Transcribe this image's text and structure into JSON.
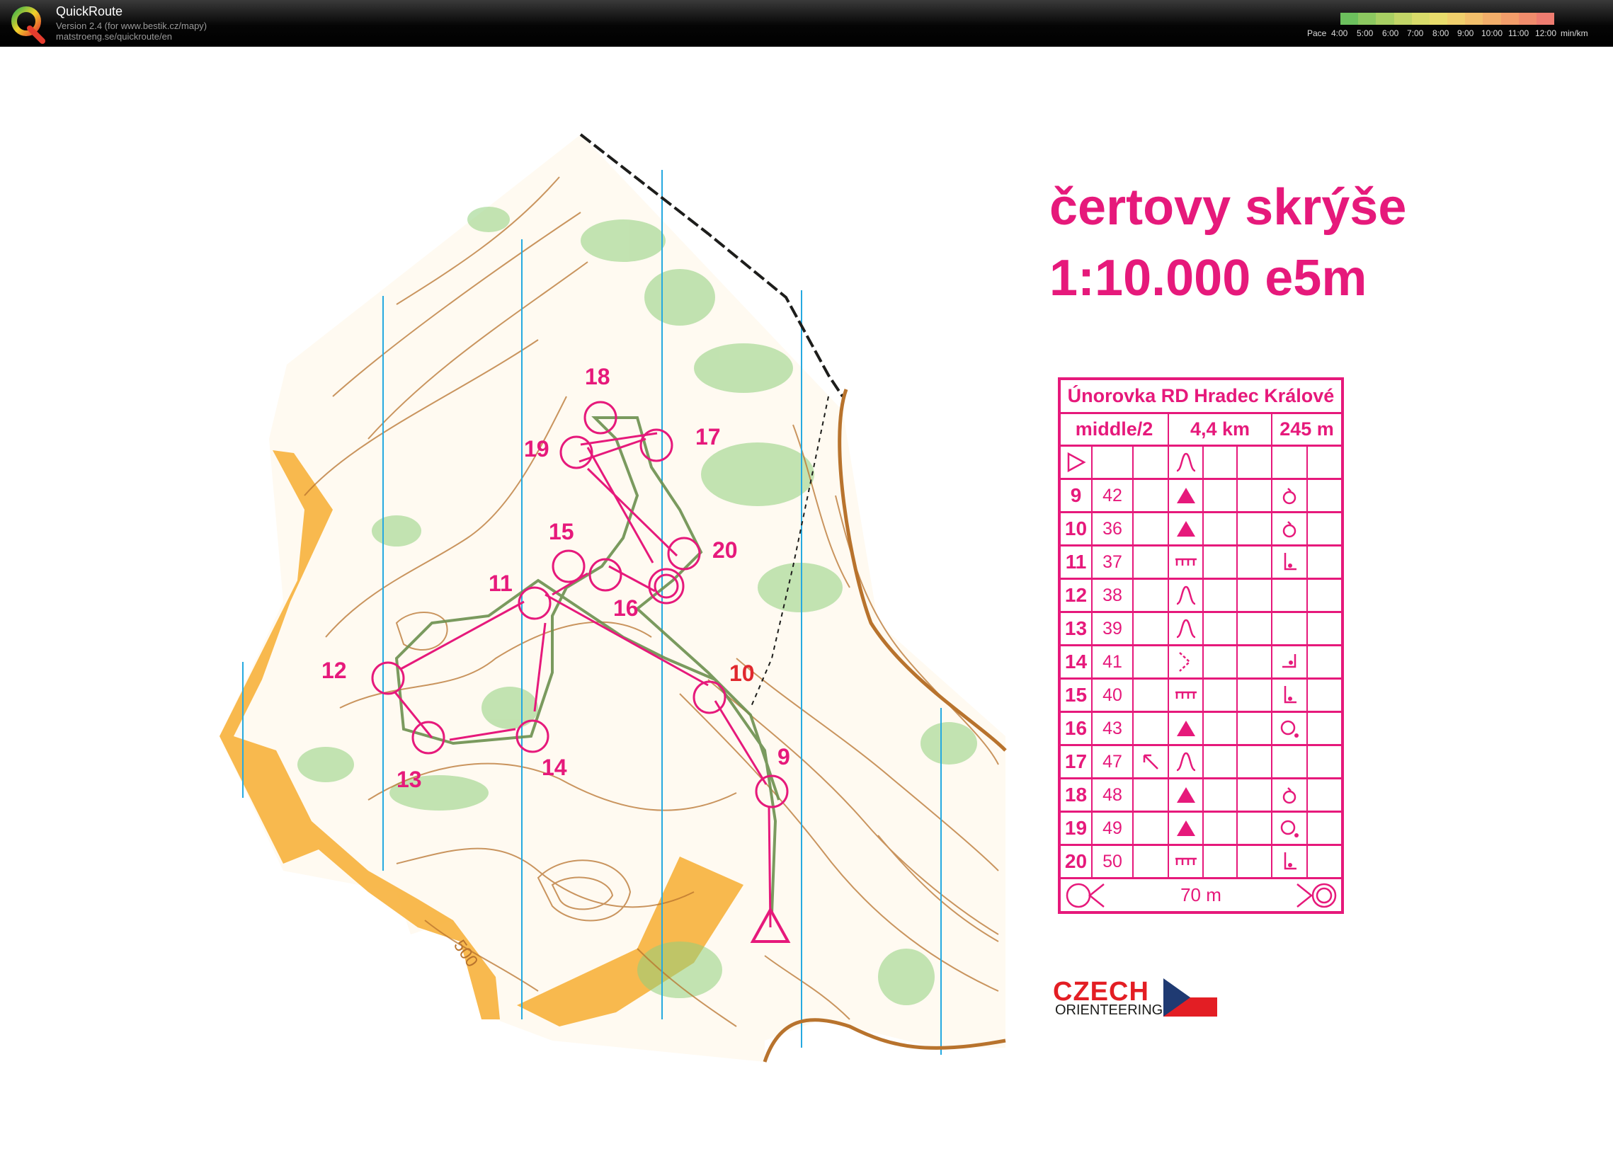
{
  "app": {
    "name": "QuickRoute",
    "version": "Version 2.4  (for www.bestik.cz/mapy)",
    "url": "matstroeng.se/quickroute/en"
  },
  "pace_legend": {
    "label": "Pace",
    "ticks": [
      "4:00",
      "5:00",
      "6:00",
      "7:00",
      "8:00",
      "9:00",
      "10:00",
      "11:00",
      "12:00"
    ],
    "unit": "min/km",
    "colors": [
      "#6cc05d",
      "#8cc860",
      "#a8cf63",
      "#c2d567",
      "#d8db6a",
      "#e9dc6c",
      "#f0cf6c",
      "#f2bf6b",
      "#f2ae6a",
      "#f29d6a",
      "#f08c6c",
      "#ee7c70"
    ]
  },
  "map": {
    "title": "čertovy skrýše",
    "scale_line": "1:10.000  e5m",
    "contour_label": "500",
    "colors": {
      "course": "#e6197b",
      "contour": "#b8732d",
      "water": "#26a9e0",
      "green": "#8fd07b",
      "open": "#f7b13c"
    },
    "controls": [
      "9",
      "10",
      "11",
      "12",
      "13",
      "14",
      "15",
      "16",
      "17",
      "18",
      "19",
      "20"
    ]
  },
  "control_descriptions": {
    "event": "Únorovka RD Hradec Králové",
    "class": "middle/2",
    "length": "4,4 km",
    "climb": "245 m",
    "finish_distance": "70 m",
    "rows": [
      {
        "num": "9",
        "code": "42",
        "feature": "knoll-icon",
        "position": "ring-icon"
      },
      {
        "num": "10",
        "code": "36",
        "feature": "knoll-icon",
        "position": "ring-icon"
      },
      {
        "num": "11",
        "code": "37",
        "feature": "cliff-icon",
        "position": "foot-icon"
      },
      {
        "num": "12",
        "code": "38",
        "feature": "spur-icon",
        "position": ""
      },
      {
        "num": "13",
        "code": "39",
        "feature": "spur-icon",
        "position": ""
      },
      {
        "num": "14",
        "code": "41",
        "feature": "reentrant-icon",
        "position": "corner-icon"
      },
      {
        "num": "15",
        "code": "40",
        "feature": "cliff-icon",
        "position": "foot-icon"
      },
      {
        "num": "16",
        "code": "43",
        "feature": "knoll-icon",
        "position": "side-icon"
      },
      {
        "num": "17",
        "code": "47",
        "which": "arrow-icon",
        "feature": "spur-icon",
        "position": ""
      },
      {
        "num": "18",
        "code": "48",
        "feature": "knoll-icon",
        "position": "ring-icon"
      },
      {
        "num": "19",
        "code": "49",
        "feature": "knoll-icon",
        "position": "side-icon"
      },
      {
        "num": "20",
        "code": "50",
        "feature": "cliff-icon",
        "position": "foot-icon"
      }
    ]
  },
  "federation_logo": {
    "line1": "CZECH",
    "line2": "ORIENTEERING"
  }
}
